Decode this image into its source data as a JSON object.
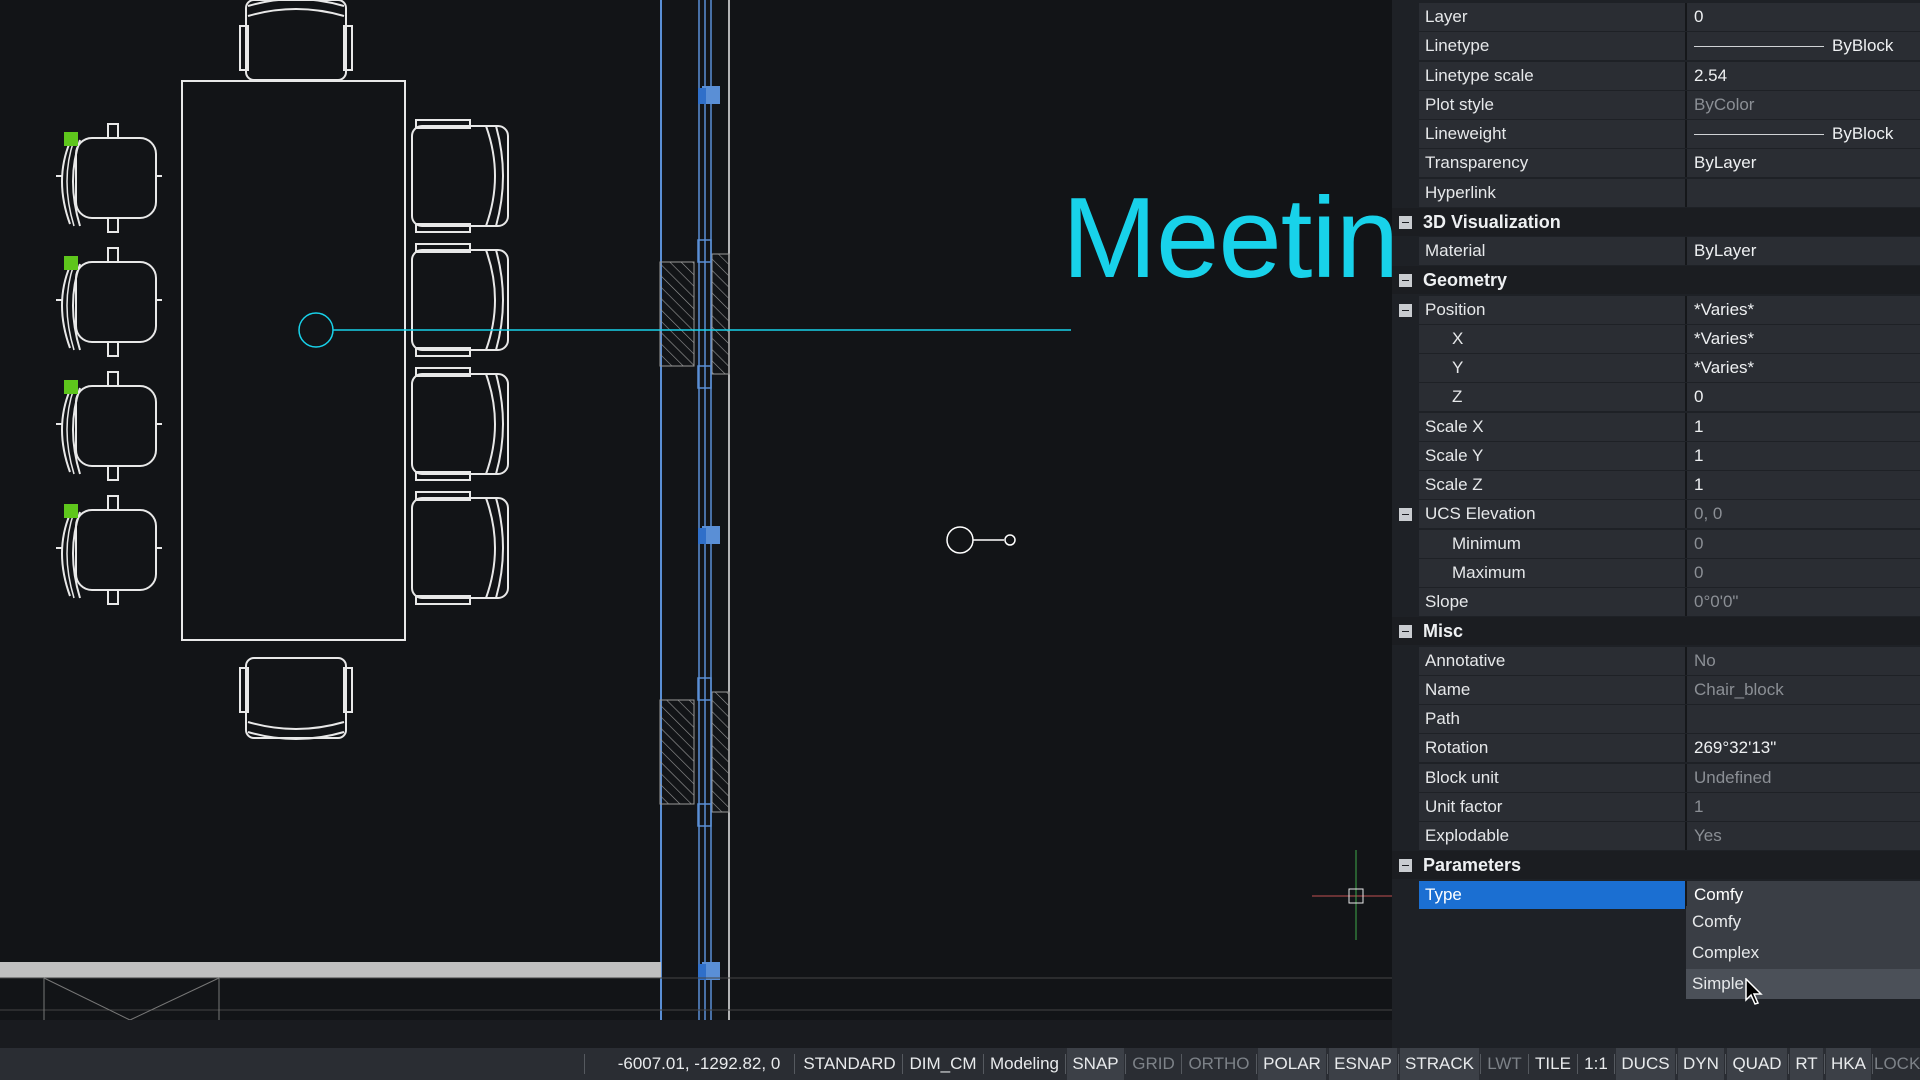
{
  "canvas": {
    "title_text": "Meetin"
  },
  "properties": {
    "rows": [
      {
        "type": "prop",
        "name": "Layer",
        "value": "0"
      },
      {
        "type": "prop",
        "name": "Linetype",
        "value": "ByBlock",
        "line": true
      },
      {
        "type": "prop",
        "name": "Linetype scale",
        "value": "2.54"
      },
      {
        "type": "prop",
        "name": "Plot style",
        "value": "ByColor",
        "readonly": true
      },
      {
        "type": "prop",
        "name": "Lineweight",
        "value": "ByBlock",
        "line": true
      },
      {
        "type": "prop",
        "name": "Transparency",
        "value": "ByLayer"
      },
      {
        "type": "prop",
        "name": "Hyperlink",
        "value": ""
      },
      {
        "type": "cat",
        "name": "3D Visualization"
      },
      {
        "type": "prop",
        "name": "Material",
        "value": "ByLayer"
      },
      {
        "type": "cat",
        "name": "Geometry"
      },
      {
        "type": "prop",
        "name": "Position",
        "value": "*Varies*",
        "toggle": true
      },
      {
        "type": "prop",
        "name": "X",
        "value": "*Varies*",
        "indent": true
      },
      {
        "type": "prop",
        "name": "Y",
        "value": "*Varies*",
        "indent": true
      },
      {
        "type": "prop",
        "name": "Z",
        "value": "0",
        "indent": true
      },
      {
        "type": "prop",
        "name": "Scale X",
        "value": "1"
      },
      {
        "type": "prop",
        "name": "Scale Y",
        "value": "1"
      },
      {
        "type": "prop",
        "name": "Scale Z",
        "value": "1"
      },
      {
        "type": "prop",
        "name": "UCS Elevation",
        "value": "0, 0",
        "readonly": true,
        "toggle": true
      },
      {
        "type": "prop",
        "name": "Minimum",
        "value": "0",
        "readonly": true,
        "indent": true
      },
      {
        "type": "prop",
        "name": "Maximum",
        "value": "0",
        "readonly": true,
        "indent": true
      },
      {
        "type": "prop",
        "name": "Slope",
        "value": "0°0'0\"",
        "readonly": true
      },
      {
        "type": "cat",
        "name": "Misc"
      },
      {
        "type": "prop",
        "name": "Annotative",
        "value": "No",
        "readonly": true
      },
      {
        "type": "prop",
        "name": "Name",
        "value": "Chair_block",
        "readonly": true
      },
      {
        "type": "prop",
        "name": "Path",
        "value": ""
      },
      {
        "type": "prop",
        "name": "Rotation",
        "value": "269°32'13\""
      },
      {
        "type": "prop",
        "name": "Block unit",
        "value": "Undefined",
        "readonly": true
      },
      {
        "type": "prop",
        "name": "Unit factor",
        "value": "1",
        "readonly": true
      },
      {
        "type": "prop",
        "name": "Explodable",
        "value": "Yes",
        "readonly": true
      },
      {
        "type": "cat",
        "name": "Parameters"
      },
      {
        "type": "prop",
        "name": "Type",
        "value": "Comfy",
        "selected": true
      }
    ],
    "dropdown": {
      "options": [
        "Comfy",
        "Complex",
        "Simple"
      ],
      "hovered": "Simple"
    }
  },
  "status_bar": {
    "coords": "-6007.01, -1292.82, 0",
    "items": [
      {
        "label": "STANDARD",
        "state": "text"
      },
      {
        "label": "DIM_CM",
        "state": "text"
      },
      {
        "label": "Modeling",
        "state": "text"
      },
      {
        "label": "SNAP",
        "state": "on"
      },
      {
        "label": "GRID",
        "state": "off"
      },
      {
        "label": "ORTHO",
        "state": "off"
      },
      {
        "label": "POLAR",
        "state": "on"
      },
      {
        "label": "ESNAP",
        "state": "on"
      },
      {
        "label": "STRACK",
        "state": "on"
      },
      {
        "label": "LWT",
        "state": "off"
      },
      {
        "label": "TILE",
        "state": "text"
      },
      {
        "label": "1:1",
        "state": "text"
      },
      {
        "label": "DUCS",
        "state": "on"
      },
      {
        "label": "DYN",
        "state": "on"
      },
      {
        "label": "QUAD",
        "state": "on"
      },
      {
        "label": "RT",
        "state": "on"
      },
      {
        "label": "HKA",
        "state": "on"
      },
      {
        "label": "LOCKUI",
        "state": "off"
      },
      {
        "label": "None",
        "state": "text"
      }
    ]
  },
  "colors": {
    "accent": "#1b6fd2",
    "cad_text": "#18d2ea",
    "wall": "#5a8fd6"
  }
}
